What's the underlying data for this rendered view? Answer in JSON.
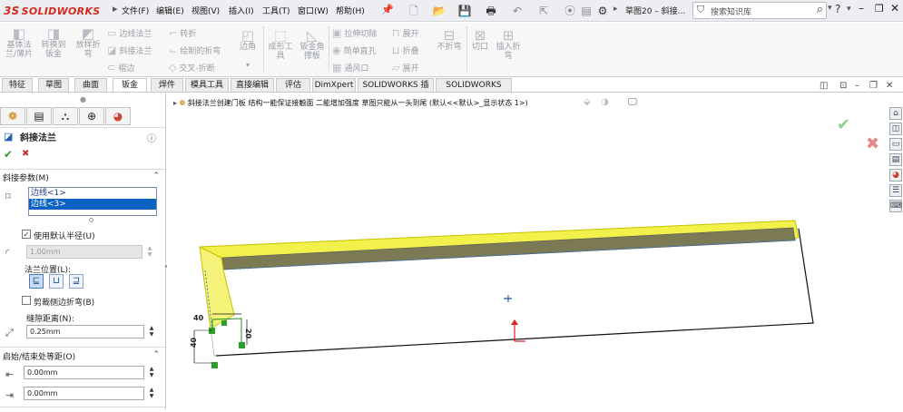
{
  "app": {
    "logo_text": "SOLIDWORKS",
    "logo_prefix": "3S",
    "doc_title": "草图20 – 斜接...",
    "search_placeholder": "搜索知识库",
    "help_icon": "?",
    "menus": [
      "文件(F)",
      "编辑(E)",
      "视图(V)",
      "插入(I)",
      "工具(T)",
      "窗口(W)",
      "帮助(H)"
    ]
  },
  "ribbon": {
    "buttons": [
      {
        "label": "基体法\n兰/薄片",
        "icon": "base-flange-icon"
      },
      {
        "label": "转换到\n钣金",
        "icon": "convert-to-sheetmetal-icon"
      },
      {
        "label": "放样折\n弯",
        "icon": "lofted-bend-icon"
      },
      {
        "label": "边角",
        "icon": "corner-icon"
      },
      {
        "label": "成形工\n具",
        "icon": "forming-tool-icon"
      },
      {
        "label": "钣金角\n撑板",
        "icon": "gusset-icon"
      },
      {
        "label": "不折弯",
        "icon": "no-bends-icon"
      },
      {
        "label": "切口",
        "icon": "rip-icon"
      },
      {
        "label": "插入折\n弯",
        "icon": "insert-bends-icon"
      }
    ],
    "rows": [
      {
        "label": "边线法兰",
        "icon": "edge-flange-icon"
      },
      {
        "label": "斜接法兰",
        "icon": "miter-flange-icon"
      },
      {
        "label": "褶边",
        "icon": "hem-icon"
      },
      {
        "label": "转折",
        "icon": "jog-icon"
      },
      {
        "label": "绘制的折弯",
        "icon": "sketched-bend-icon"
      },
      {
        "label": "交叉-折断",
        "icon": "cross-break-icon"
      },
      {
        "label": "拉伸切除",
        "icon": "extruded-cut-icon"
      },
      {
        "label": "简单直孔",
        "icon": "simple-hole-icon"
      },
      {
        "label": "通风口",
        "icon": "vent-icon"
      },
      {
        "label": "展开",
        "icon": "unfold-icon"
      },
      {
        "label": "折叠",
        "icon": "fold-icon"
      },
      {
        "label": "展开",
        "icon": "flatten-icon"
      }
    ]
  },
  "tabs": [
    "特征",
    "草图",
    "曲面",
    "钣金",
    "焊件",
    "模具工具",
    "直接编辑",
    "评估",
    "DimXpert",
    "SOLIDWORKS 插件",
    "SOLIDWORKS MBD"
  ],
  "active_tab": "钣金",
  "panel": {
    "title": "斜接法兰",
    "ok": "✔",
    "cancel": "✖",
    "section_params": "斜接参数(M)",
    "edges": [
      "边线<1>",
      "边线<3>"
    ],
    "use_default_radius": "使用默认半径(U)",
    "radius_value": "1.00mm",
    "flange_position": "法兰位置(L):",
    "trim_side_bends": "剪裁侧边折弯(B)",
    "gap_distance": "缝隙距离(N):",
    "gap_value": "0.25mm",
    "section_offset": "启始/结束处等距(O)",
    "start_offset": "0.00mm",
    "end_offset": "0.00mm"
  },
  "viewport": {
    "breadcrumb": "斜接法兰创建门板 结构一能保证接触面 二能增加强度 草图只能从一头到尾 (默认<<默认>_显示状态 1>)",
    "dim_top": "40",
    "dim_left": "40",
    "dim_right": "20"
  },
  "colors": {
    "accent": "#d52b1e",
    "selection": "#0a63c2",
    "highlight_yellow": "#f2f04a",
    "ok_green": "#2a9d2a",
    "cancel_red": "#c9302c"
  }
}
